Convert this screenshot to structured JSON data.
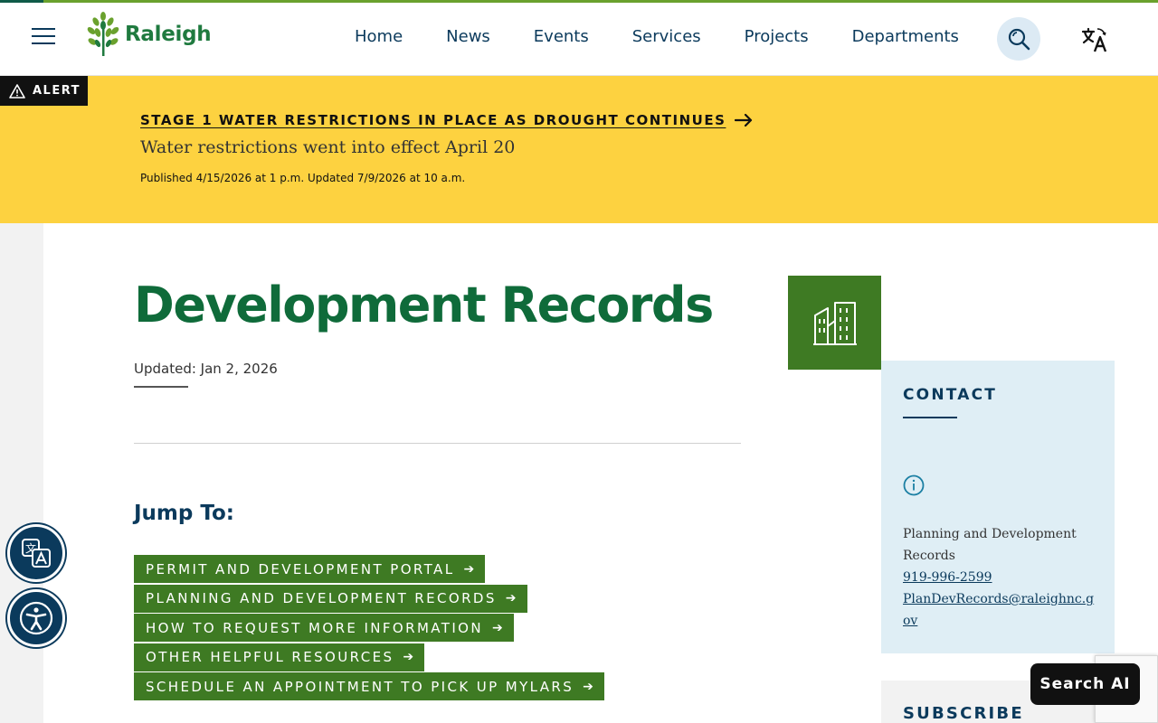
{
  "header": {
    "logo_text": "Raleigh",
    "nav": [
      "Home",
      "News",
      "Events",
      "Services",
      "Projects",
      "Departments"
    ]
  },
  "alert": {
    "tag": "ALERT",
    "title": "STAGE 1 WATER RESTRICTIONS IN PLACE AS DROUGHT CONTINUES",
    "subtitle": "Water restrictions went into effect April 20",
    "meta": "Published 4/15/2026 at 1 p.m.  Updated 7/9/2026 at 10 a.m."
  },
  "main": {
    "title": "Development Records",
    "updated": "Updated: Jan 2, 2026",
    "jump_title": "Jump To:",
    "jump_links": [
      "PERMIT AND DEVELOPMENT PORTAL",
      "PLANNING AND DEVELOPMENT RECORDS",
      "HOW TO REQUEST MORE INFORMATION",
      "OTHER HELPFUL RESOURCES",
      "SCHEDULE AN APPOINTMENT TO PICK UP MYLARS"
    ],
    "arrow": "➔"
  },
  "sidebar": {
    "contact_title": "CONTACT",
    "contact_name": "Planning and Development Records",
    "phone": "919-996-2599",
    "email": "PlanDevRecords@raleighnc.gov",
    "subscribe_title": "SUBSCRIBE"
  },
  "widgets": {
    "search_ai": "Search AI"
  },
  "icons": {
    "menu": "hamburger-icon",
    "search": "magnifier-icon",
    "translate": "translate-icon",
    "alert": "warning-triangle-icon",
    "department": "buildings-icon",
    "info": "info-circle-icon",
    "accessibility": "accessibility-person-icon"
  },
  "colors": {
    "brand_green": "#3e7a23",
    "title_green": "#0f6b3a",
    "navy": "#0b3a5c",
    "alert_yellow": "#fdd240",
    "contact_bg": "#dfeef5"
  }
}
